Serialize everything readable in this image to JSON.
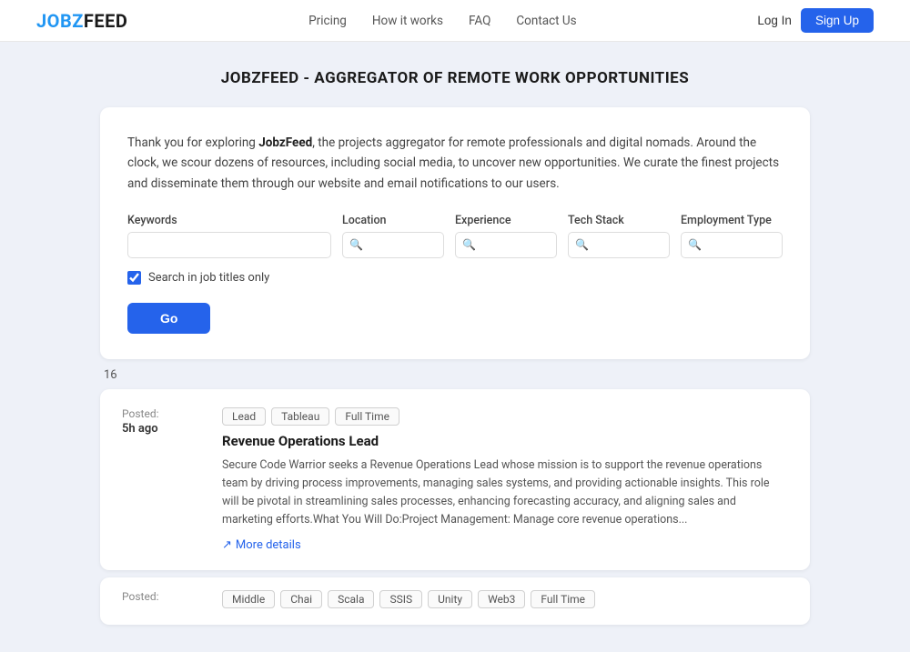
{
  "brand": {
    "logo_jobs": "JOBZ",
    "logo_feed": "FEED",
    "full_logo": "JOBZFEED"
  },
  "navbar": {
    "links": [
      {
        "label": "Pricing",
        "id": "pricing"
      },
      {
        "label": "How it works",
        "id": "how-it-works"
      },
      {
        "label": "FAQ",
        "id": "faq"
      },
      {
        "label": "Contact Us",
        "id": "contact-us"
      }
    ],
    "login_label": "Log In",
    "signup_label": "Sign Up"
  },
  "page": {
    "title": "JOBZFEED - AGGREGATOR OF REMOTE WORK OPPORTUNITIES"
  },
  "search_card": {
    "intro": "Thank you for exploring ",
    "brand_name": "JobzFeed",
    "intro_rest": ", the projects aggregator for remote professionals and digital nomads. Around the clock, we scour dozens of resources, including social media, to uncover new opportunities. We curate the finest projects and disseminate them through our website and email notifications to our users.",
    "fields": {
      "keywords": {
        "label": "Keywords",
        "placeholder": ""
      },
      "location": {
        "label": "Location",
        "placeholder": ""
      },
      "experience": {
        "label": "Experience",
        "placeholder": ""
      },
      "tech_stack": {
        "label": "Tech Stack",
        "placeholder": ""
      },
      "employment_type": {
        "label": "Employment Type",
        "placeholder": ""
      }
    },
    "checkbox_label": "Search in job titles only",
    "go_button": "Go"
  },
  "results": {
    "count": "16",
    "jobs": [
      {
        "posted_label": "Posted:",
        "time": "5h ago",
        "tags": [
          "Lead",
          "Tableau",
          "Full Time"
        ],
        "title": "Revenue Operations Lead",
        "description": "Secure Code Warrior seeks a Revenue Operations Lead whose mission is to support the revenue operations team by driving process improvements, managing sales systems, and providing actionable insights. This role will be pivotal in streamlining sales processes, enhancing forecasting accuracy, and aligning sales and marketing efforts.What You Will Do:Project Management: Manage core revenue operations...",
        "more_label": "More details"
      },
      {
        "posted_label": "Posted:",
        "time": "",
        "tags": [
          "Middle",
          "Chai",
          "Scala",
          "SSIS",
          "Unity",
          "Web3",
          "Full Time"
        ],
        "title": "",
        "description": ""
      }
    ]
  }
}
